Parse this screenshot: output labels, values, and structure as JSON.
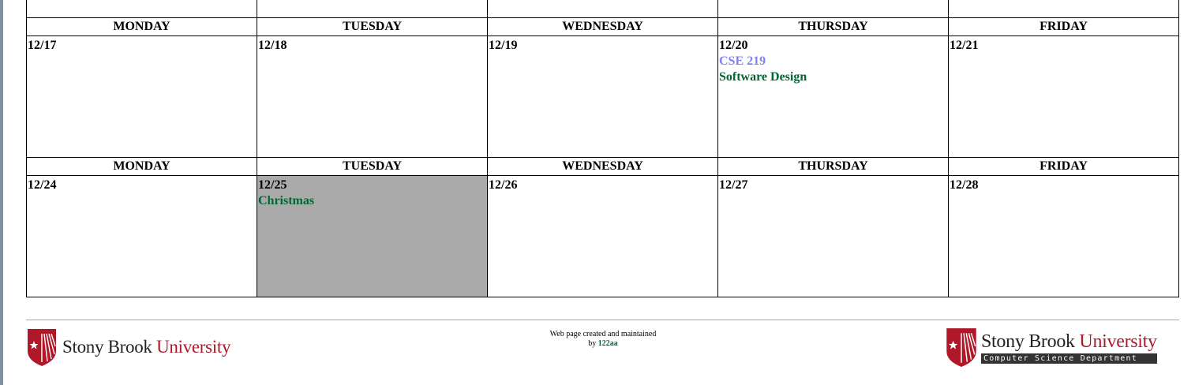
{
  "weekdays": [
    "MONDAY",
    "TUESDAY",
    "WEDNESDAY",
    "THURSDAY",
    "FRIDAY"
  ],
  "weeks": [
    {
      "days": [
        {
          "date": "12/17",
          "events": []
        },
        {
          "date": "12/18",
          "events": []
        },
        {
          "date": "12/19",
          "events": []
        },
        {
          "date": "12/20",
          "events": [
            {
              "text": "CSE 219",
              "kind": "course"
            },
            {
              "text": "Software Design",
              "kind": "title"
            }
          ]
        },
        {
          "date": "12/21",
          "events": []
        }
      ]
    },
    {
      "days": [
        {
          "date": "12/24",
          "events": []
        },
        {
          "date": "12/25",
          "events": [
            {
              "text": "Christmas",
              "kind": "holiday"
            }
          ],
          "holiday": true
        },
        {
          "date": "12/26",
          "events": []
        },
        {
          "date": "12/27",
          "events": []
        },
        {
          "date": "12/28",
          "events": []
        }
      ]
    }
  ],
  "footer": {
    "left_logo": {
      "name_black": "Stony Brook",
      "name_red": "University"
    },
    "credit_line1": "Web page created and maintained",
    "credit_by": "by",
    "credit_name": "122aa",
    "right_logo": {
      "name_black": "Stony Brook",
      "name_red": "University",
      "department": "Computer Science Department"
    }
  },
  "colors": {
    "course": "#8080ff",
    "event_green": "#006633",
    "holiday_bg": "#aaaaaa",
    "brand_red": "#b0182a"
  }
}
